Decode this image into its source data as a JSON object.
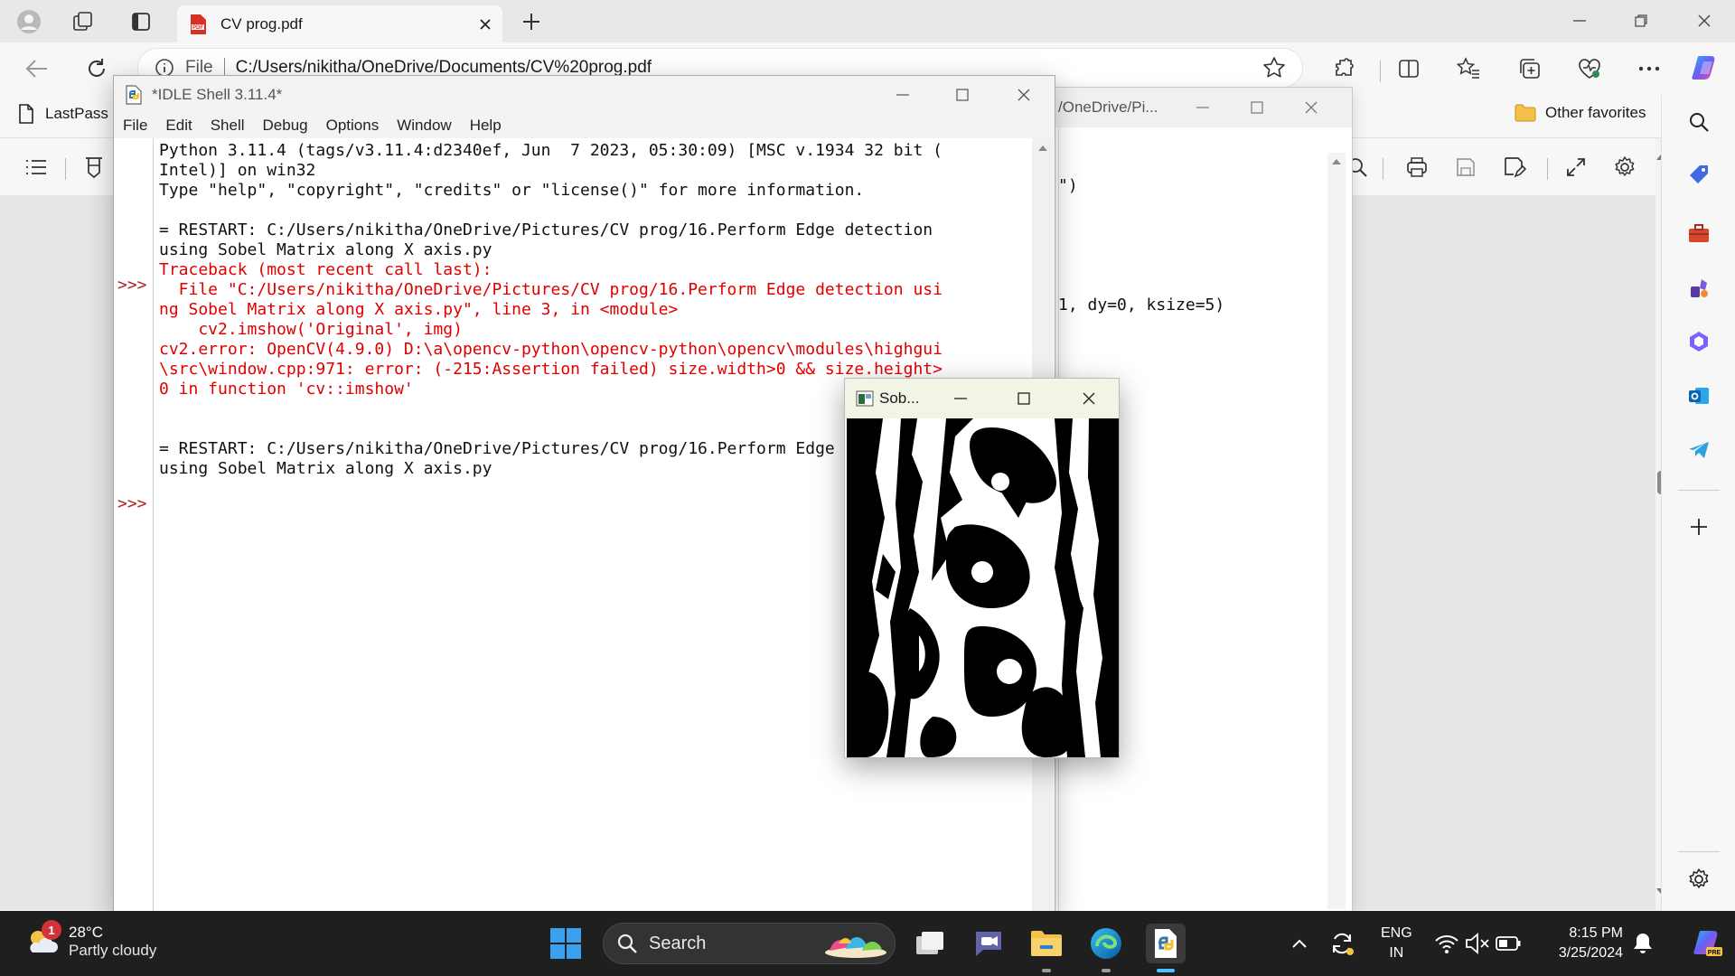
{
  "browser": {
    "tab_title": "CV prog.pdf",
    "address_label": "File",
    "address_url": "C:/Users/nikitha/OneDrive/Documents/CV%20prog.pdf",
    "favorites": {
      "lastpass": "LastPass",
      "other": "Other favorites"
    }
  },
  "editor_window": {
    "title": "/OneDrive/Pi...",
    "code_lines": [
      "\")",
      "1, dy=0, ksize=5)"
    ]
  },
  "idle": {
    "title": "*IDLE Shell 3.11.4*",
    "menu": [
      "File",
      "Edit",
      "Shell",
      "Debug",
      "Options",
      "Window",
      "Help"
    ],
    "prompt": ">>>",
    "lines": [
      {
        "text": "Python 3.11.4 (tags/v3.11.4:d2340ef, Jun  7 2023, 05:30:09) [MSC v.1934 32 bit (",
        "kind": "out"
      },
      {
        "text": "Intel)] on win32",
        "kind": "out"
      },
      {
        "text": "Type \"help\", \"copyright\", \"credits\" or \"license()\" for more information.",
        "kind": "out"
      },
      {
        "text": "",
        "kind": "out"
      },
      {
        "text": "= RESTART: C:/Users/nikitha/OneDrive/Pictures/CV prog/16.Perform Edge detection",
        "kind": "out"
      },
      {
        "text": "using Sobel Matrix along X axis.py",
        "kind": "out"
      },
      {
        "text": "Traceback (most recent call last):",
        "kind": "err"
      },
      {
        "text": "  File \"C:/Users/nikitha/OneDrive/Pictures/CV prog/16.Perform Edge detection usi",
        "kind": "err"
      },
      {
        "text": "ng Sobel Matrix along X axis.py\", line 3, in <module>",
        "kind": "err"
      },
      {
        "text": "    cv2.imshow('Original', img)",
        "kind": "err"
      },
      {
        "text": "cv2.error: OpenCV(4.9.0) D:\\a\\opencv-python\\opencv-python\\opencv\\modules\\highgui",
        "kind": "err"
      },
      {
        "text": "\\src\\window.cpp:971: error: (-215:Assertion failed) size.width>0 && size.height>",
        "kind": "err"
      },
      {
        "text": "0 in function 'cv::imshow'",
        "kind": "err"
      },
      {
        "text": "",
        "kind": "out"
      },
      {
        "text": "",
        "kind": "out"
      },
      {
        "text": "= RESTART: C:/Users/nikitha/OneDrive/Pictures/CV prog/16.Perform Edge detection",
        "kind": "out"
      },
      {
        "text": "using Sobel Matrix along X axis.py",
        "kind": "out"
      }
    ]
  },
  "sobel_window": {
    "title": "Sob..."
  },
  "taskbar": {
    "weather_badge": "1",
    "temperature": "28°C",
    "condition": "Partly cloudy",
    "search_placeholder": "Search",
    "lang_top": "ENG",
    "lang_bottom": "IN",
    "time": "8:15 PM",
    "date": "3/25/2024"
  },
  "colors": {
    "idle_error": "#e00000",
    "idle_prompt": "#b22222",
    "taskbar": "#1f1f1f",
    "edge_accent": "#1a73e8"
  },
  "icons": [
    "profile-icon",
    "workspaces-icon",
    "tab-actions-icon",
    "pdf-icon",
    "back-icon",
    "refresh-icon",
    "info-icon",
    "star-icon",
    "extensions-icon",
    "split-screen-icon",
    "favorites-icon",
    "collections-icon",
    "browser-essentials-icon",
    "more-icon",
    "copilot-icon",
    "document-icon",
    "folder-icon",
    "contents-icon",
    "draw-icon",
    "search-icon",
    "print-icon",
    "save-icon",
    "save-as-icon",
    "fullscreen-icon",
    "settings-icon",
    "python-idle-icon",
    "windows-start-icon"
  ]
}
